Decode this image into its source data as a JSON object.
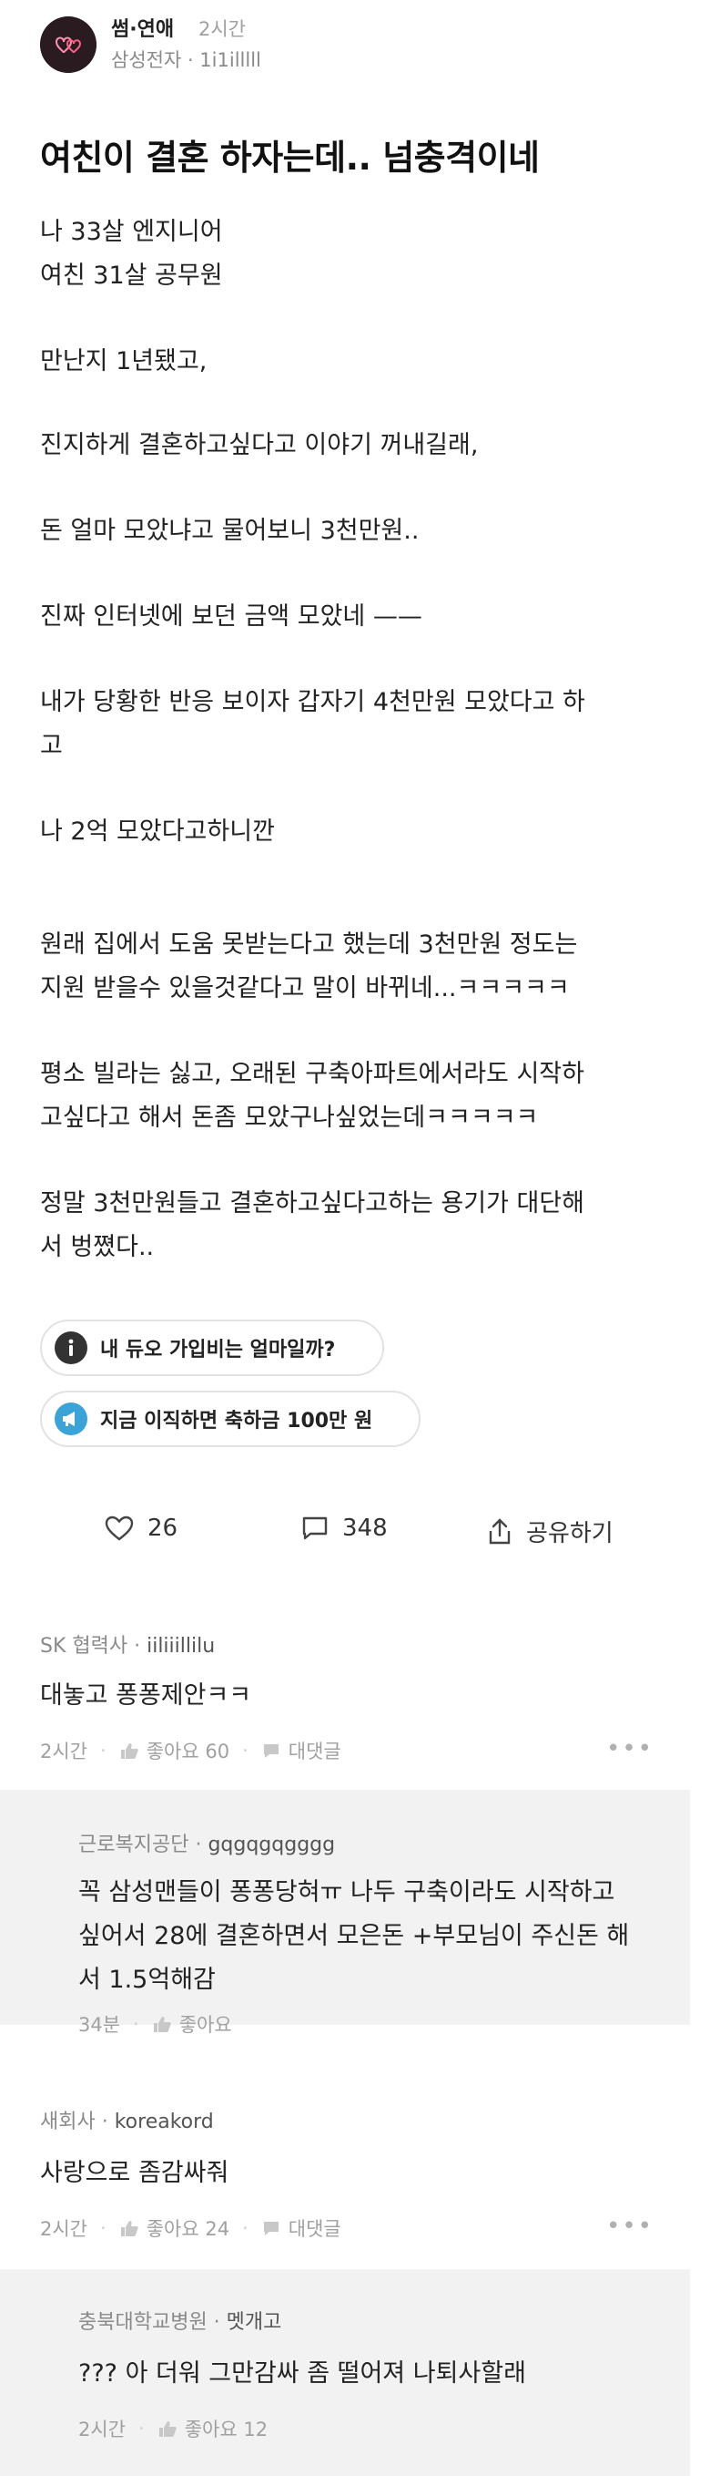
{
  "post": {
    "channel": "썸·연애",
    "time": "2시간",
    "author": "삼성전자 · 1i1illlll",
    "title": "여친이 결혼 하자는데.. 넘충격이네",
    "lines": [
      "나 33살 엔지니어",
      "여친 31살 공무원",
      "만난지 1년됐고,",
      "진지하게 결혼하고싶다고 이야기 꺼내길래,",
      "돈 얼마 모았냐고 물어보니 3천만원..",
      "진짜 인터넷에 보던 금액 모았네 ——",
      "내가 당황한 반응 보이자 갑자기 4천만원 모았다고 하",
      "고",
      "나 2억 모았다고하니깐",
      "원래 집에서 도움 못받는다고 했는데 3천만원 정도는",
      "지원 받을수 있을것같다고 말이 바뀌네...ㅋㅋㅋㅋㅋ",
      "평소 빌라는 싫고, 오래된 구축아파트에서라도 시작하",
      "고싶다고 해서 돈좀 모았구나싶었는데ㅋㅋㅋㅋㅋ",
      "정말 3천만원들고 결혼하고싶다고하는 용기가 대단해",
      "서 벙쪘다.."
    ]
  },
  "banners": [
    {
      "text": "내 듀오 가입비는 얼마일까?",
      "icon": "info-icon"
    },
    {
      "text": "지금 이직하면 축하금 100만 원",
      "icon": "megaphone-icon"
    }
  ],
  "actions": {
    "likes": "26",
    "comments": "348",
    "share": "공유하기"
  },
  "comments": [
    {
      "company": "SK 협력사",
      "user": "iiliiillilu",
      "text": [
        "대놓고 퐁퐁제안ㅋㅋ"
      ],
      "time": "2시간",
      "like_label": "좋아요 60",
      "reply_label": "대댓글",
      "more": "•••"
    },
    {
      "company": "근로복지공단",
      "user": "gqgqgqgggg",
      "text": [
        "꼭 삼성맨들이 퐁퐁당혀ㅠ 나두 구축이라도 시작하고",
        "싶어서 28에 결혼하면서 모은돈 +부모님이 주신돈 해",
        "서 1.5억해감"
      ],
      "time": "34분",
      "like_label": "좋아요"
    },
    {
      "company": "새회사",
      "user": "koreakord",
      "text": [
        "사랑으로 좀감싸줘"
      ],
      "time": "2시간",
      "like_label": "좋아요 24",
      "reply_label": "대댓글",
      "more": "•••"
    },
    {
      "company": "충북대학교병원",
      "user": "멧개고",
      "text": [
        "??? 아 더워 그만감싸 좀 떨어져 나퇴사할래"
      ],
      "time": "2시간",
      "like_label": "좋아요 12"
    }
  ],
  "colors": {
    "text": "#111111",
    "meta": "#8a8a8a",
    "reply_bg": "#f2f2f3",
    "banner_info": "#333333",
    "banner_megaphone": "#3aa3d8"
  }
}
